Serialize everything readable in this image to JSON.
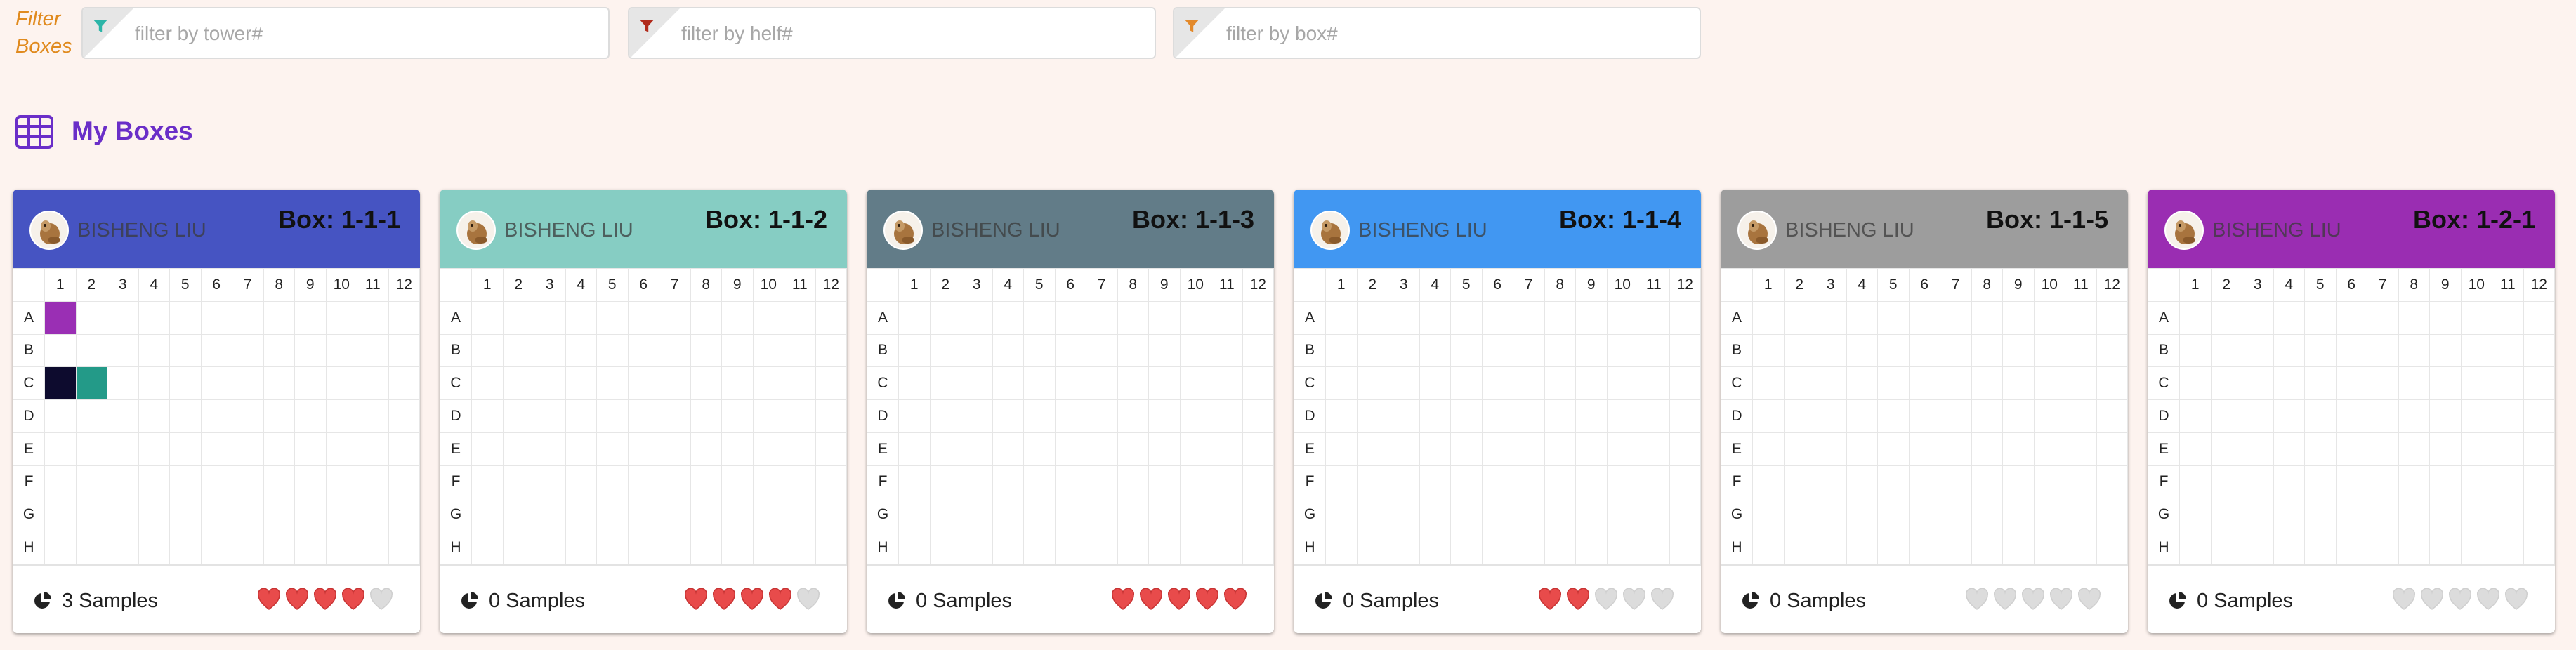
{
  "filter": {
    "label": "Filter Boxes",
    "tower_placeholder": "filter by tower#",
    "shelf_placeholder": "filter by helf#",
    "box_placeholder": "filter by box#",
    "tower_icon_color": "#2cb5a8",
    "shelf_icon_color": "#b12a1b",
    "box_icon_color": "#e3892a"
  },
  "section": {
    "title": "My Boxes",
    "icon": "grid-table-icon"
  },
  "grid": {
    "columns": [
      "1",
      "2",
      "3",
      "4",
      "5",
      "6",
      "7",
      "8",
      "9",
      "10",
      "11",
      "12"
    ],
    "rows": [
      "A",
      "B",
      "C",
      "D",
      "E",
      "F",
      "G",
      "H"
    ]
  },
  "colors": {
    "heart_filled": "#e84b4b",
    "heart_empty": "#dcdcdc",
    "accent_purple": "#6a2ec8"
  },
  "boxes": [
    {
      "owner": "BISHENG LIU",
      "name": "Box: 1-1-1",
      "header_color": "#4654c2",
      "samples": "3 Samples",
      "rating": 4,
      "occupied": [
        {
          "row": "A",
          "col": 1,
          "color": "#9a2fb4"
        },
        {
          "row": "C",
          "col": 1,
          "color": "#0d0b2e"
        },
        {
          "row": "C",
          "col": 2,
          "color": "#239a88"
        }
      ]
    },
    {
      "owner": "BISHENG LIU",
      "name": "Box: 1-1-2",
      "header_color": "#86cdc3",
      "samples": "0 Samples",
      "rating": 4,
      "occupied": []
    },
    {
      "owner": "BISHENG LIU",
      "name": "Box: 1-1-3",
      "header_color": "#627c88",
      "samples": "0 Samples",
      "rating": 5,
      "occupied": []
    },
    {
      "owner": "BISHENG LIU",
      "name": "Box: 1-1-4",
      "header_color": "#4197f2",
      "samples": "0 Samples",
      "rating": 2,
      "occupied": []
    },
    {
      "owner": "BISHENG LIU",
      "name": "Box: 1-1-5",
      "header_color": "#9d9d9d",
      "samples": "0 Samples",
      "rating": 0,
      "occupied": []
    },
    {
      "owner": "BISHENG LIU",
      "name": "Box: 1-2-1",
      "header_color": "#9a2db2",
      "samples": "0 Samples",
      "rating": 0,
      "occupied": []
    }
  ]
}
